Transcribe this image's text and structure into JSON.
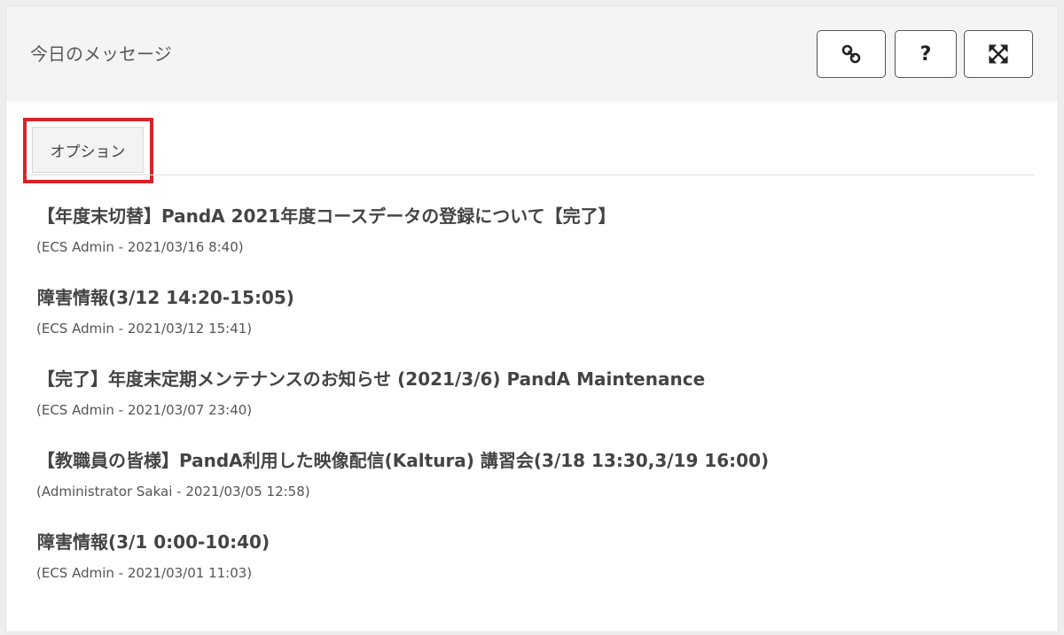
{
  "header": {
    "title": "今日のメッセージ",
    "buttons": [
      {
        "name": "link-icon",
        "label": ""
      },
      {
        "name": "help",
        "label": "?"
      },
      {
        "name": "expand-icon",
        "label": ""
      }
    ]
  },
  "options": {
    "label": "オプション",
    "highlight_color": "#d8232a"
  },
  "messages": [
    {
      "title": "【年度末切替】PandA 2021年度コースデータの登録について【完了】",
      "meta": "(ECS Admin - 2021/03/16 8:40)"
    },
    {
      "title": "障害情報(3/12 14:20-15:05)",
      "meta": "(ECS Admin - 2021/03/12 15:41)"
    },
    {
      "title": "【完了】年度末定期メンテナンスのお知らせ (2021/3/6) PandA Maintenance",
      "meta": "(ECS Admin - 2021/03/07 23:40)"
    },
    {
      "title": "【教職員の皆様】PandA利用した映像配信(Kaltura) 講習会(3/18 13:30,3/19 16:00)",
      "meta": "(Administrator Sakai - 2021/03/05 12:58)"
    },
    {
      "title": "障害情報(3/1 0:00-10:40)",
      "meta": "(ECS Admin - 2021/03/01 11:03)"
    }
  ]
}
